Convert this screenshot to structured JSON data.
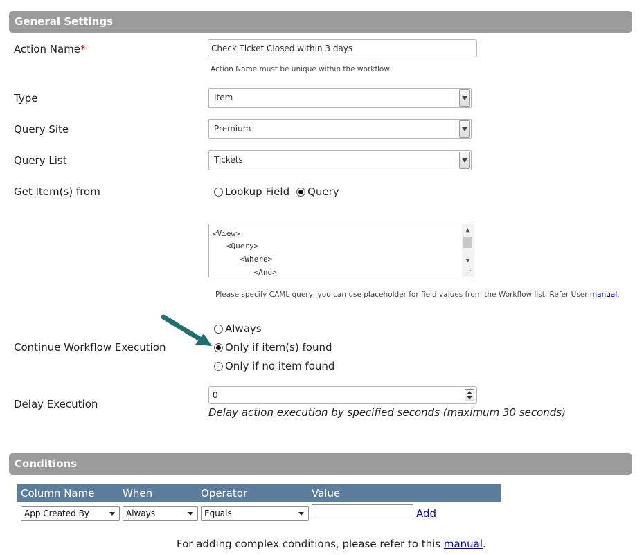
{
  "general": {
    "header": "General Settings",
    "action_name_label": "Action Name",
    "required_mark": "*",
    "action_name_value": "Check Ticket Closed within 3 days",
    "action_name_hint": "Action Name must be unique within the workflow",
    "type_label": "Type",
    "type_value": "Item",
    "query_site_label": "Query Site",
    "query_site_value": "Premium",
    "query_list_label": "Query List",
    "query_list_value": "Tickets",
    "get_items_label": "Get Item(s) from",
    "get_items_options": [
      "Lookup Field",
      "Query"
    ],
    "get_items_selected": "Query",
    "caml_lines": [
      "<View>",
      "   <Query>",
      "      <Where>",
      "         <And>"
    ],
    "caml_hint": "Please specify CAML query, you can use placeholder for field values from the Workflow list. Refer User",
    "caml_hint_link": "manual",
    "continue_label": "Continue Workflow Execution",
    "continue_options": [
      "Always",
      "Only if item(s) found",
      "Only if no item found"
    ],
    "continue_selected": "Only if item(s) found",
    "delay_label": "Delay Execution",
    "delay_value": "0",
    "delay_note": "Delay action execution by specified seconds (maximum 30 seconds)"
  },
  "conditions": {
    "header": "Conditions",
    "columns": [
      "Column Name",
      "When",
      "Operator",
      "Value"
    ],
    "row": {
      "column_name": "App Created By",
      "when": "Always",
      "operator": "Equals",
      "value": "",
      "add_link": "Add"
    },
    "footer_text": "For adding complex conditions, please refer to this",
    "footer_link": "manual",
    "footer_end": "."
  },
  "colors": {
    "section_header_bg": "#9b9b9b",
    "table_header_bg": "#5e7d9d",
    "arrow": "#1f6f6f",
    "link": "#0000cc"
  }
}
